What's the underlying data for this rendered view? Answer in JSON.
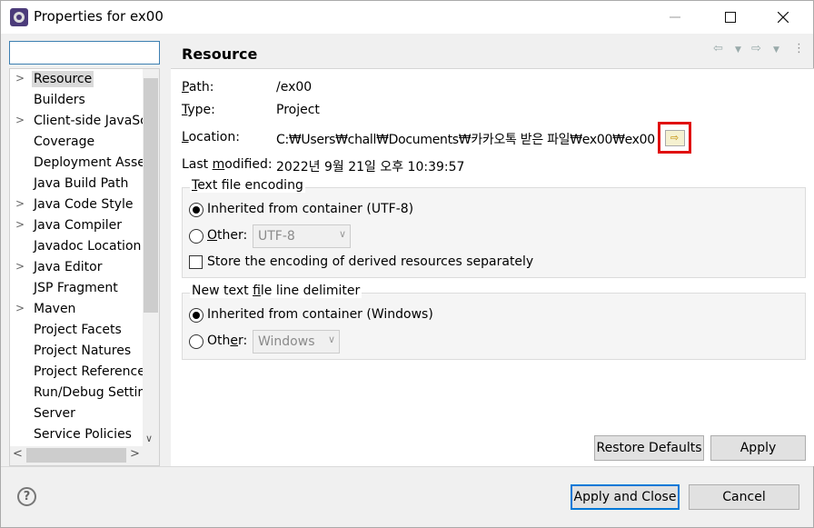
{
  "window": {
    "title": "Properties for ex00"
  },
  "filter": {
    "value": ""
  },
  "tree": {
    "items": [
      {
        "label": "Resource",
        "expandable": true,
        "selected": true
      },
      {
        "label": "Builders",
        "expandable": false
      },
      {
        "label": "Client-side JavaSc",
        "expandable": true
      },
      {
        "label": "Coverage",
        "expandable": false
      },
      {
        "label": "Deployment Asser",
        "expandable": false
      },
      {
        "label": "Java Build Path",
        "expandable": false
      },
      {
        "label": "Java Code Style",
        "expandable": true
      },
      {
        "label": "Java Compiler",
        "expandable": true
      },
      {
        "label": "Javadoc Location",
        "expandable": false
      },
      {
        "label": "Java Editor",
        "expandable": true
      },
      {
        "label": "JSP Fragment",
        "expandable": false
      },
      {
        "label": "Maven",
        "expandable": true
      },
      {
        "label": "Project Facets",
        "expandable": false
      },
      {
        "label": "Project Natures",
        "expandable": false
      },
      {
        "label": "Project Reference",
        "expandable": false
      },
      {
        "label": "Run/Debug Settir",
        "expandable": false
      },
      {
        "label": "Server",
        "expandable": false
      },
      {
        "label": "Service Policies",
        "expandable": false
      }
    ]
  },
  "page": {
    "title": "Resource",
    "path": {
      "label": "Path:",
      "value": "/ex00"
    },
    "type": {
      "label": "Type:",
      "value": "Project"
    },
    "location": {
      "label": "Location:",
      "value": "C:₩Users₩chall₩Documents₩카카오톡 받은 파일₩ex00₩ex00"
    },
    "modified": {
      "label": "Last modified:",
      "value": "2022년 9월 21일 오후 10:39:57"
    }
  },
  "encoding": {
    "title": "Text file encoding",
    "inherited": "Inherited from container (UTF-8)",
    "other": "Other:",
    "other_value": "UTF-8",
    "store_derived": "Store the encoding of derived resources separately"
  },
  "delimiter": {
    "title": "New text file line delimiter",
    "inherited": "Inherited from container (Windows)",
    "other": "Other:",
    "other_value": "Windows"
  },
  "buttons": {
    "restore_defaults": "Restore Defaults",
    "apply": "Apply",
    "apply_close": "Apply and Close",
    "cancel": "Cancel"
  },
  "colors": {
    "highlight": "#e01010",
    "default_button_border": "#0078d7",
    "selection": "#d9d9d9"
  },
  "icons": {
    "app": "eclipse-gear-icon",
    "help": "help-icon",
    "location": "open-folder-icon",
    "nav": [
      "back-arrow-icon",
      "forward-arrow-icon",
      "view-menu-icon"
    ]
  }
}
